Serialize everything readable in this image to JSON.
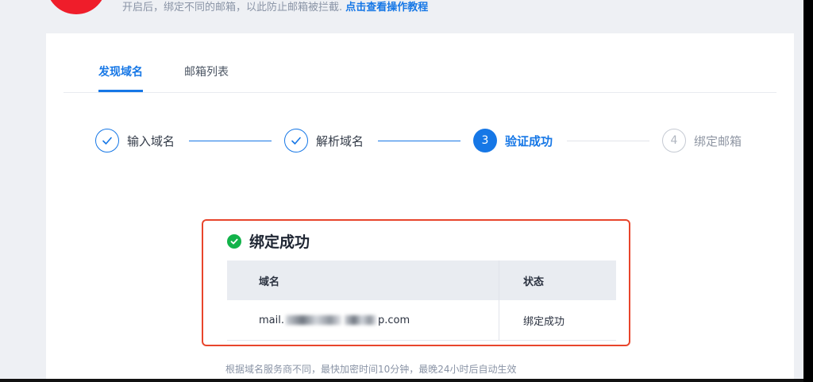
{
  "header": {
    "hint_text": "开启后，绑定不同的邮箱，以此防止邮箱被拦截. ",
    "tutorial_link": "点击查看操作教程"
  },
  "tabs": [
    {
      "label": "发现域名",
      "active": true
    },
    {
      "label": "邮箱列表",
      "active": false
    }
  ],
  "steps": [
    {
      "label": "输入域名",
      "state": "done",
      "number": ""
    },
    {
      "label": "解析域名",
      "state": "done",
      "number": ""
    },
    {
      "label": "验证成功",
      "state": "current",
      "number": "3"
    },
    {
      "label": "绑定邮箱",
      "state": "pending",
      "number": "4"
    }
  ],
  "result": {
    "title": "绑定成功",
    "columns": [
      "域名",
      "状态"
    ],
    "rows": [
      {
        "domain_prefix": "mail.",
        "domain_suffix": "p.com",
        "status": "绑定成功"
      }
    ]
  },
  "note": "根据域名服务商不同，最快加密时间10分钟，最晚24小时后自动生效",
  "colors": {
    "primary": "#1677e6",
    "success": "#12b34a",
    "highlight_border": "#e8452c",
    "logo": "#ef1d2a"
  }
}
